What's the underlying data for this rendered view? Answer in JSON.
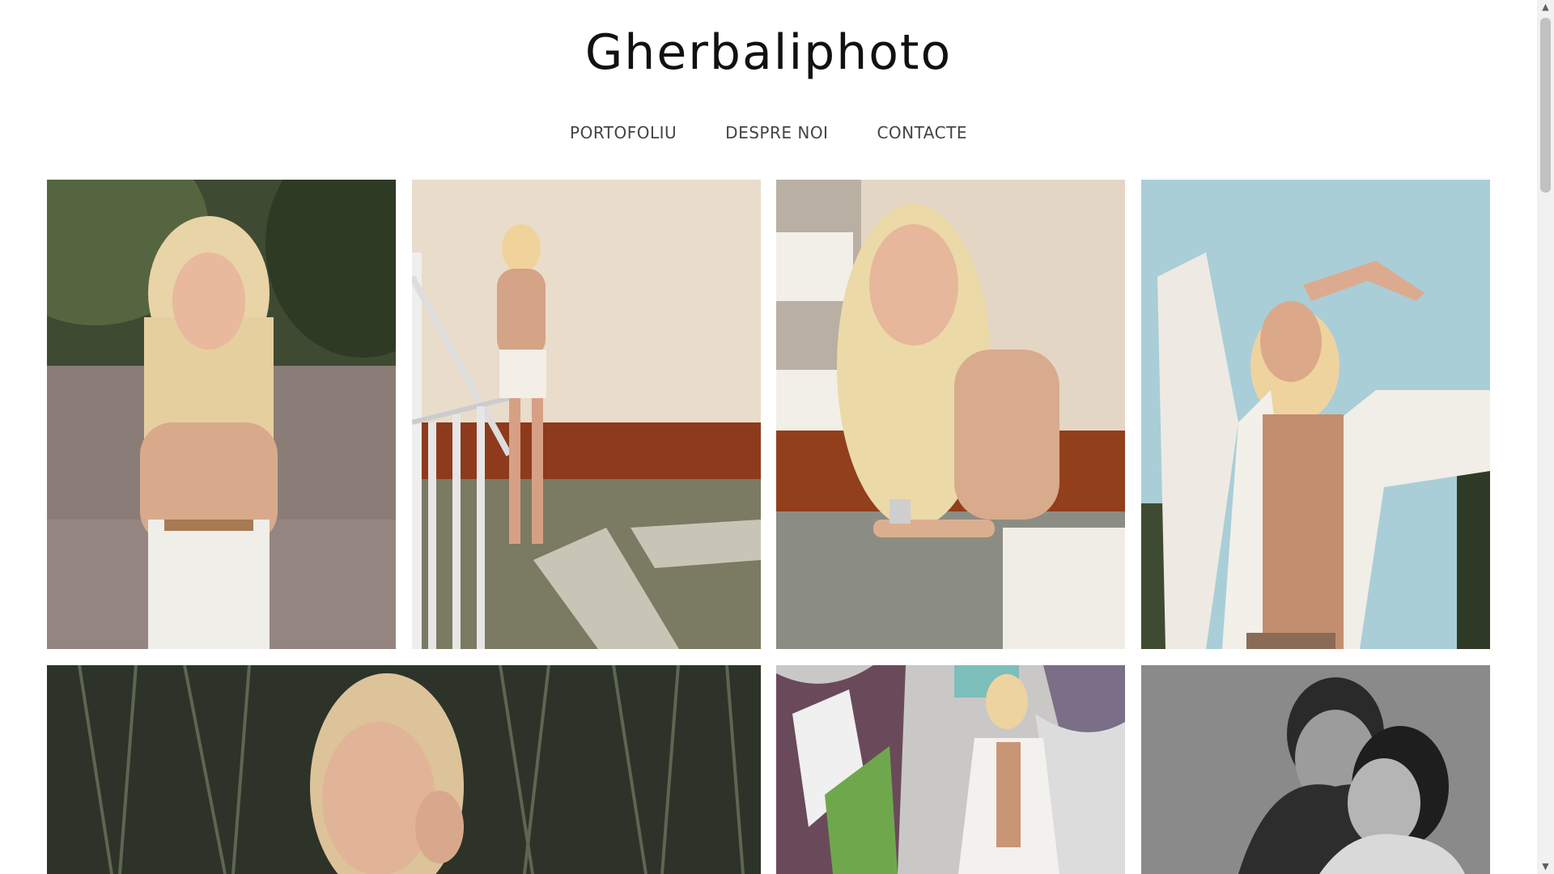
{
  "site": {
    "title": "Gherbaliphoto"
  },
  "nav": {
    "items": [
      {
        "label": "PORTOFOLIU"
      },
      {
        "label": "DESPRE NOI"
      },
      {
        "label": "CONTACTE"
      }
    ]
  },
  "gallery": {
    "photos": [
      {
        "subject": "blonde model in beige bodysuit and white trousers, park path"
      },
      {
        "subject": "blonde model leaning on railing by brick wall"
      },
      {
        "subject": "blonde model close-up leaning on railing"
      },
      {
        "subject": "model in white blazer against blue sky"
      },
      {
        "subject": "model portrait among tall reeds"
      },
      {
        "subject": "model in white suit by graffiti wall"
      },
      {
        "subject": "black and white couple portrait"
      }
    ]
  },
  "colors": {
    "title": "#111111",
    "nav_text": "#444444",
    "background": "#ffffff"
  },
  "icons": {
    "scroll_up": "chevron-up-icon",
    "scroll_down": "chevron-down-icon"
  }
}
